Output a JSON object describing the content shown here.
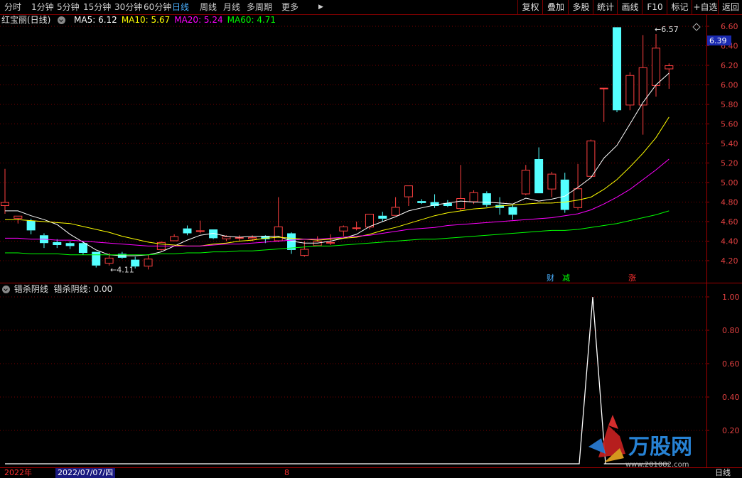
{
  "toolbar": {
    "periods": [
      "分时",
      "1分钟",
      "5分钟",
      "15分钟",
      "30分钟",
      "60分钟",
      "日线",
      "周线",
      "月线",
      "多周期",
      "更多"
    ],
    "active_period": "日线",
    "right_buttons": [
      "复权",
      "叠加",
      "多股",
      "统计",
      "画线",
      "F10",
      "标记",
      "+自选",
      "返回"
    ]
  },
  "main_header": {
    "stock_name": "红宝丽(日线)",
    "ma": [
      {
        "label": "MA5: 6.12",
        "color": "#ffffff"
      },
      {
        "label": "MA10: 5.67",
        "color": "#ffff00"
      },
      {
        "label": "MA20: 5.24",
        "color": "#ff00ff"
      },
      {
        "label": "MA60: 4.71",
        "color": "#00ff00"
      }
    ]
  },
  "sub_header": {
    "indicator_name": "错杀阴线",
    "indicator_value": "错杀阴线: 0.00"
  },
  "price_axis": {
    "ticks": [
      "6.60",
      "6.40",
      "6.20",
      "6.00",
      "5.80",
      "5.60",
      "5.40",
      "5.20",
      "5.00",
      "4.80",
      "4.60",
      "4.40",
      "4.20"
    ]
  },
  "price_marker": "6.39",
  "annotations": {
    "high_label": "6.57",
    "low_label": "4.11"
  },
  "event_markers": [
    {
      "text": "财",
      "color": "#4ab0ff"
    },
    {
      "text": "减",
      "color": "#00ff00"
    },
    {
      "text": "涨",
      "color": "#ff3030"
    }
  ],
  "sub_axis": {
    "ticks": [
      "1.00",
      "0.80",
      "0.60",
      "0.40",
      "0.20"
    ]
  },
  "bottom": {
    "year": "2022年",
    "date": "2022/07/07/四",
    "month_mark": "8",
    "period_label": "日线"
  },
  "watermark": {
    "logo_text": "万股网",
    "url": "www.201082.com"
  },
  "chart_data": {
    "type": "candlestick",
    "ylim": [
      4.1,
      6.62
    ],
    "candles": [
      [
        4.76,
        4.8,
        5.14,
        4.68
      ],
      [
        4.63,
        4.66,
        4.66,
        4.58
      ],
      [
        4.61,
        4.51,
        4.63,
        4.47
      ],
      [
        4.46,
        4.38,
        4.48,
        4.33
      ],
      [
        4.39,
        4.36,
        4.42,
        4.33
      ],
      [
        4.38,
        4.35,
        4.4,
        4.32
      ],
      [
        4.38,
        4.28,
        4.4,
        4.26
      ],
      [
        4.29,
        4.15,
        4.29,
        4.13
      ],
      [
        4.17,
        4.23,
        4.28,
        4.15
      ],
      [
        4.27,
        4.23,
        4.29,
        4.22
      ],
      [
        4.21,
        4.14,
        4.24,
        4.12
      ],
      [
        4.14,
        4.22,
        4.26,
        4.11
      ],
      [
        4.31,
        4.39,
        4.4,
        4.3
      ],
      [
        4.4,
        4.45,
        4.47,
        4.4
      ],
      [
        4.53,
        4.48,
        4.56,
        4.46
      ],
      [
        4.5,
        4.51,
        4.61,
        4.48
      ],
      [
        4.52,
        4.43,
        4.52,
        4.42
      ],
      [
        4.42,
        4.45,
        4.46,
        4.4
      ],
      [
        4.43,
        4.44,
        4.46,
        4.4
      ],
      [
        4.42,
        4.44,
        4.46,
        4.4
      ],
      [
        4.45,
        4.42,
        4.46,
        4.38
      ],
      [
        4.4,
        4.55,
        4.85,
        4.39
      ],
      [
        4.48,
        4.31,
        4.49,
        4.27
      ],
      [
        4.25,
        4.32,
        4.4,
        4.24
      ],
      [
        4.35,
        4.4,
        4.45,
        4.35
      ],
      [
        4.39,
        4.39,
        4.47,
        4.36
      ],
      [
        4.5,
        4.55,
        4.56,
        4.45
      ],
      [
        4.53,
        4.54,
        4.6,
        4.51
      ],
      [
        4.54,
        4.68,
        4.68,
        4.52
      ],
      [
        4.66,
        4.63,
        4.7,
        4.6
      ],
      [
        4.66,
        4.75,
        4.85,
        4.66
      ],
      [
        4.85,
        4.97,
        4.97,
        4.76
      ],
      [
        4.81,
        4.79,
        4.83,
        4.78
      ],
      [
        4.8,
        4.76,
        4.88,
        4.74
      ],
      [
        4.79,
        4.76,
        4.82,
        4.75
      ],
      [
        4.73,
        4.84,
        5.18,
        4.71
      ],
      [
        4.8,
        4.9,
        4.92,
        4.78
      ],
      [
        4.89,
        4.77,
        4.91,
        4.75
      ],
      [
        4.77,
        4.74,
        4.85,
        4.67
      ],
      [
        4.75,
        4.67,
        4.77,
        4.62
      ],
      [
        4.88,
        5.13,
        5.18,
        4.87
      ],
      [
        5.24,
        4.89,
        5.36,
        4.89
      ],
      [
        4.93,
        5.09,
        5.11,
        4.85
      ],
      [
        5.03,
        4.72,
        5.1,
        4.69
      ],
      [
        4.74,
        4.94,
        5.19,
        4.72
      ],
      [
        5.06,
        5.43,
        5.44,
        5.05
      ],
      [
        5.97,
        5.97,
        5.97,
        5.62
      ],
      [
        6.59,
        5.74,
        6.59,
        5.72
      ],
      [
        5.79,
        6.1,
        6.13,
        5.74
      ],
      [
        5.79,
        6.18,
        6.51,
        5.49
      ],
      [
        5.99,
        6.38,
        6.52,
        5.88
      ],
      [
        6.16,
        6.2,
        6.22,
        5.96
      ]
    ],
    "ma_lines": {
      "MA5": [
        4.71,
        4.71,
        4.66,
        4.62,
        4.57,
        4.47,
        4.39,
        4.31,
        4.26,
        4.25,
        4.25,
        4.26,
        4.29,
        4.35,
        4.41,
        4.46,
        4.48,
        4.45,
        4.44,
        4.45,
        4.45,
        4.45,
        4.4,
        4.38,
        4.38,
        4.4,
        4.43,
        4.47,
        4.55,
        4.6,
        4.65,
        4.71,
        4.74,
        4.77,
        4.79,
        4.81,
        4.8,
        4.8,
        4.79,
        4.78,
        4.84,
        4.81,
        4.83,
        4.86,
        4.95,
        5.05,
        5.25,
        5.38,
        5.6,
        5.82,
        6.0,
        6.12
      ],
      "MA10": [
        4.62,
        4.62,
        4.61,
        4.6,
        4.59,
        4.58,
        4.55,
        4.52,
        4.49,
        4.45,
        4.42,
        4.39,
        4.37,
        4.36,
        4.35,
        4.35,
        4.37,
        4.38,
        4.4,
        4.41,
        4.43,
        4.44,
        4.43,
        4.42,
        4.41,
        4.42,
        4.43,
        4.44,
        4.47,
        4.51,
        4.54,
        4.58,
        4.62,
        4.66,
        4.69,
        4.71,
        4.73,
        4.74,
        4.76,
        4.77,
        4.78,
        4.79,
        4.79,
        4.8,
        4.82,
        4.85,
        4.93,
        5.03,
        5.16,
        5.3,
        5.46,
        5.67
      ],
      "MA20": [
        4.43,
        4.43,
        4.42,
        4.42,
        4.41,
        4.41,
        4.4,
        4.39,
        4.38,
        4.37,
        4.36,
        4.35,
        4.35,
        4.35,
        4.35,
        4.35,
        4.36,
        4.37,
        4.37,
        4.38,
        4.39,
        4.4,
        4.41,
        4.42,
        4.42,
        4.43,
        4.44,
        4.45,
        4.46,
        4.48,
        4.5,
        4.52,
        4.53,
        4.54,
        4.56,
        4.57,
        4.58,
        4.59,
        4.6,
        4.61,
        4.62,
        4.63,
        4.64,
        4.66,
        4.68,
        4.72,
        4.78,
        4.85,
        4.93,
        5.03,
        5.13,
        5.24
      ],
      "MA60": [
        4.28,
        4.28,
        4.27,
        4.27,
        4.27,
        4.26,
        4.26,
        4.26,
        4.26,
        4.26,
        4.26,
        4.26,
        4.27,
        4.27,
        4.28,
        4.28,
        4.29,
        4.29,
        4.3,
        4.3,
        4.31,
        4.32,
        4.33,
        4.34,
        4.35,
        4.35,
        4.36,
        4.37,
        4.38,
        4.39,
        4.4,
        4.41,
        4.42,
        4.42,
        4.43,
        4.44,
        4.45,
        4.46,
        4.47,
        4.48,
        4.49,
        4.5,
        4.51,
        4.51,
        4.52,
        4.54,
        4.56,
        4.58,
        4.61,
        4.64,
        4.67,
        4.71
      ]
    },
    "indicator": {
      "name": "错杀阴线",
      "ylim": [
        0,
        1.05
      ],
      "values": [
        0,
        0,
        0,
        0,
        0,
        0,
        0,
        0,
        0,
        0,
        0,
        0,
        0,
        0,
        0,
        0,
        0,
        0,
        0,
        0,
        0,
        0,
        0,
        0,
        0,
        0,
        0,
        0,
        0,
        0,
        0,
        0,
        0,
        0,
        0,
        0,
        0,
        0,
        0,
        0,
        0,
        0,
        0,
        0,
        1,
        0,
        0,
        0,
        0,
        0,
        0,
        0
      ]
    }
  }
}
